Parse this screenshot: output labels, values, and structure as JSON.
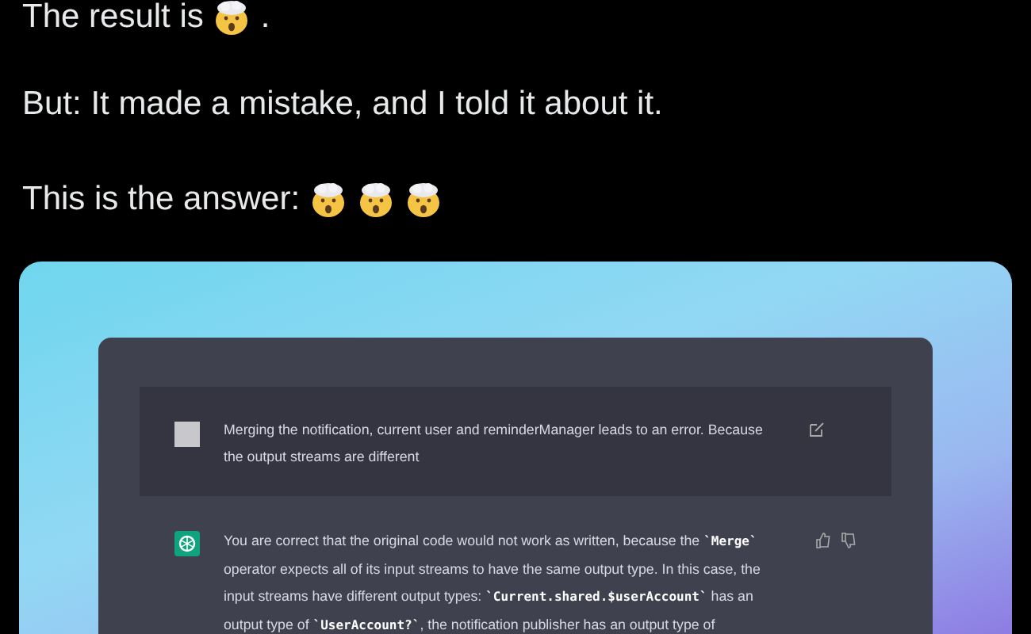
{
  "tweet": {
    "lines": [
      {
        "parts": [
          {
            "kind": "text",
            "text": "The result is"
          },
          {
            "kind": "emoji"
          },
          {
            "kind": "text",
            "text": "."
          }
        ]
      },
      {
        "parts": [
          {
            "kind": "text",
            "text": "But: It made a mistake, and I told it about it."
          }
        ]
      },
      {
        "parts": [
          {
            "kind": "text",
            "text": "This is the answer:"
          },
          {
            "kind": "emoji"
          },
          {
            "kind": "emoji"
          },
          {
            "kind": "emoji"
          }
        ]
      }
    ]
  },
  "chat": {
    "messages": [
      {
        "kind": "user",
        "segments": [
          {
            "kind": "plain",
            "text": "Merging the notification, current user and reminderManager leads to an error. Because the output streams are different"
          }
        ]
      },
      {
        "kind": "assistant",
        "segments": [
          {
            "kind": "plain",
            "text": "You are correct that the original code would not work as written, because the "
          },
          {
            "kind": "code",
            "text": "`Merge`"
          },
          {
            "kind": "plain",
            "text": " operator expects all of its input streams to have the same output type. In this case, the input streams have different output types: "
          },
          {
            "kind": "code",
            "text": "`Current.shared.$userAccount`"
          },
          {
            "kind": "plain",
            "text": " has an output type of "
          },
          {
            "kind": "code",
            "text": "`UserAccount?`"
          },
          {
            "kind": "plain",
            "text": ", the notification publisher has an output type of"
          }
        ]
      }
    ]
  }
}
